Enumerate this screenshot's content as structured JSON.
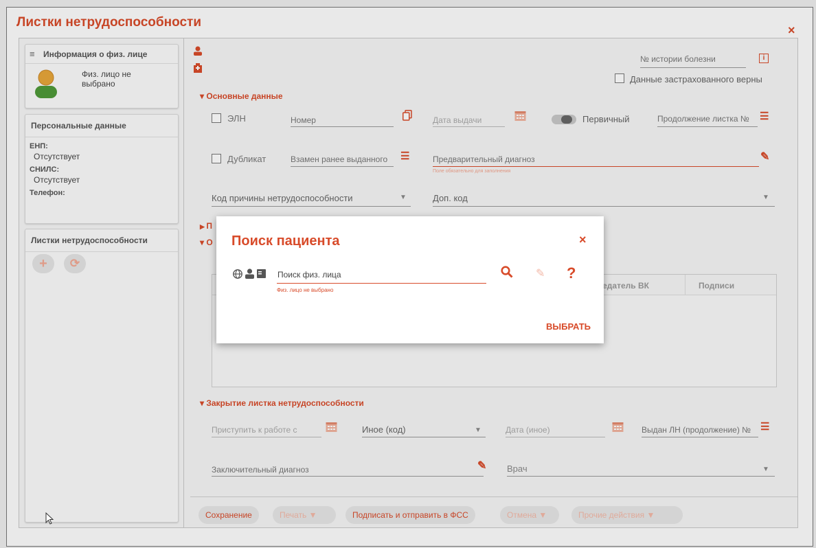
{
  "window": {
    "title": "Листки нетрудоспособности",
    "close_glyph": "×"
  },
  "person_card": {
    "header": "Информация о физ. лице",
    "person_line1": "Физ. лицо не",
    "person_line2": "выбрано"
  },
  "personal_data": {
    "header": "Персональные данные",
    "enp_label": "ЕНП:",
    "enp_value": "Отсутствует",
    "snils_label": "СНИЛС:",
    "snils_value": "Отсутствует",
    "phone_label": "Телефон:"
  },
  "sick_list_panel": {
    "header": "Листки нетрудоспособности"
  },
  "top_right": {
    "history_label": "№ истории болезни",
    "insured_data_label": "Данные застрахованного верны"
  },
  "main_section": {
    "title": "Основные данные",
    "eln_label": "ЭЛН",
    "number_label": "Номер",
    "issue_date_label": "Дата выдачи",
    "primary_label": "Первичный",
    "continuation_label": "Продолжение листка №",
    "duplicate_label": "Дубликат",
    "instead_label": "Взамен ранее выданного",
    "prelim_diag_label": "Предварительный диагноз",
    "required_hint": "Поле обязательно для заполнения",
    "reason_code_label": "Код причины нетрудоспособности",
    "extra_code_label": "Доп. код"
  },
  "hidden_sections": {
    "sec2_initial": "П",
    "sec3_initial": "О"
  },
  "table_headers": {
    "col_vk": "дседатель ВК",
    "col_signatures": "Подписи"
  },
  "closing_section": {
    "title": "Закрытие листка нетрудоспособности",
    "start_work_label": "Приступить к работе с",
    "other_code_label": "Иное (код)",
    "other_date_label": "Дата (иное)",
    "issued_ln_label": "Выдан ЛН (продолжение) №",
    "final_diag_label": "Заключительный диагноз",
    "doctor_label": "Врач"
  },
  "bottom_buttons": {
    "save": "Сохранение",
    "print": "Печать",
    "sign_send": "Подписать и отправить в ФСС",
    "cancel": "Отмена",
    "other_actions": "Прочие действия"
  },
  "dialog": {
    "title": "Поиск пациента",
    "search_label": "Поиск физ. лица",
    "error_text": "Физ. лицо не выбрано",
    "help_glyph": "?",
    "select_button": "ВЫБРАТЬ"
  },
  "colors": {
    "accent": "#d84b2a",
    "muted": "#777777"
  }
}
